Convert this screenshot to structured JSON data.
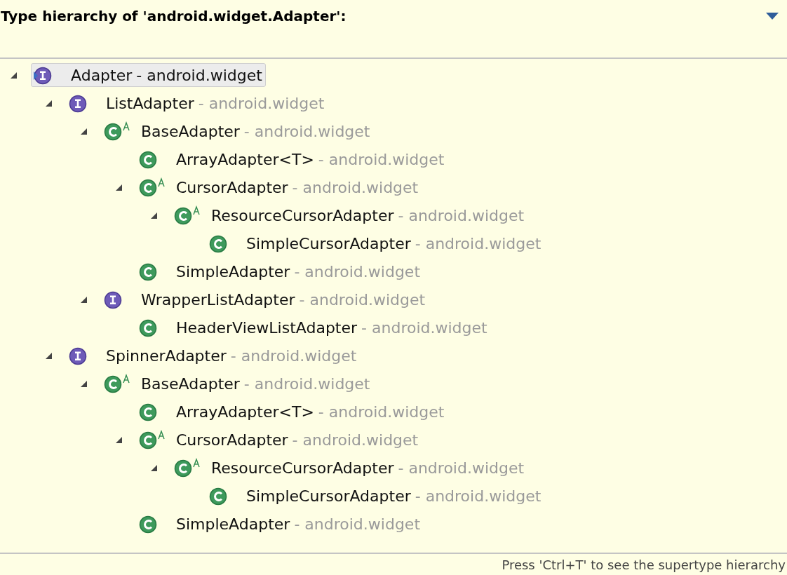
{
  "header": {
    "title": "Type hierarchy of 'android.widget.Adapter':"
  },
  "tree": [
    {
      "name": "Adapter",
      "package": "- android.widget",
      "kind": "interface",
      "abstract": false,
      "focus": true,
      "selected": true,
      "expanded": true,
      "children": [
        {
          "name": "ListAdapter",
          "package": "- android.widget",
          "kind": "interface",
          "abstract": false,
          "focus": false,
          "selected": false,
          "expanded": true,
          "children": [
            {
              "name": "BaseAdapter",
              "package": "- android.widget",
              "kind": "class",
              "abstract": true,
              "focus": false,
              "selected": false,
              "expanded": true,
              "children": [
                {
                  "name": "ArrayAdapter<T>",
                  "package": "- android.widget",
                  "kind": "class",
                  "abstract": false,
                  "focus": false,
                  "selected": false,
                  "expanded": false
                },
                {
                  "name": "CursorAdapter",
                  "package": "- android.widget",
                  "kind": "class",
                  "abstract": true,
                  "focus": false,
                  "selected": false,
                  "expanded": true,
                  "children": [
                    {
                      "name": "ResourceCursorAdapter",
                      "package": "- android.widget",
                      "kind": "class",
                      "abstract": true,
                      "focus": false,
                      "selected": false,
                      "expanded": true,
                      "children": [
                        {
                          "name": "SimpleCursorAdapter",
                          "package": "- android.widget",
                          "kind": "class",
                          "abstract": false,
                          "focus": false,
                          "selected": false,
                          "expanded": false
                        }
                      ]
                    }
                  ]
                },
                {
                  "name": "SimpleAdapter",
                  "package": "- android.widget",
                  "kind": "class",
                  "abstract": false,
                  "focus": false,
                  "selected": false,
                  "expanded": false
                }
              ]
            },
            {
              "name": "WrapperListAdapter",
              "package": "- android.widget",
              "kind": "interface",
              "abstract": false,
              "focus": false,
              "selected": false,
              "expanded": true,
              "children": [
                {
                  "name": "HeaderViewListAdapter",
                  "package": "- android.widget",
                  "kind": "class",
                  "abstract": false,
                  "focus": false,
                  "selected": false,
                  "expanded": false
                }
              ]
            }
          ]
        },
        {
          "name": "SpinnerAdapter",
          "package": "- android.widget",
          "kind": "interface",
          "abstract": false,
          "focus": false,
          "selected": false,
          "expanded": true,
          "children": [
            {
              "name": "BaseAdapter",
              "package": "- android.widget",
              "kind": "class",
              "abstract": true,
              "focus": false,
              "selected": false,
              "expanded": true,
              "children": [
                {
                  "name": "ArrayAdapter<T>",
                  "package": "- android.widget",
                  "kind": "class",
                  "abstract": false,
                  "focus": false,
                  "selected": false,
                  "expanded": false
                },
                {
                  "name": "CursorAdapter",
                  "package": "- android.widget",
                  "kind": "class",
                  "abstract": true,
                  "focus": false,
                  "selected": false,
                  "expanded": true,
                  "children": [
                    {
                      "name": "ResourceCursorAdapter",
                      "package": "- android.widget",
                      "kind": "class",
                      "abstract": true,
                      "focus": false,
                      "selected": false,
                      "expanded": true,
                      "children": [
                        {
                          "name": "SimpleCursorAdapter",
                          "package": "- android.widget",
                          "kind": "class",
                          "abstract": false,
                          "focus": false,
                          "selected": false,
                          "expanded": false
                        }
                      ]
                    }
                  ]
                },
                {
                  "name": "SimpleAdapter",
                  "package": "- android.widget",
                  "kind": "class",
                  "abstract": false,
                  "focus": false,
                  "selected": false,
                  "expanded": false
                }
              ]
            }
          ]
        }
      ]
    }
  ],
  "footer": {
    "hint": "Press 'Ctrl+T' to see the supertype hierarchy"
  }
}
